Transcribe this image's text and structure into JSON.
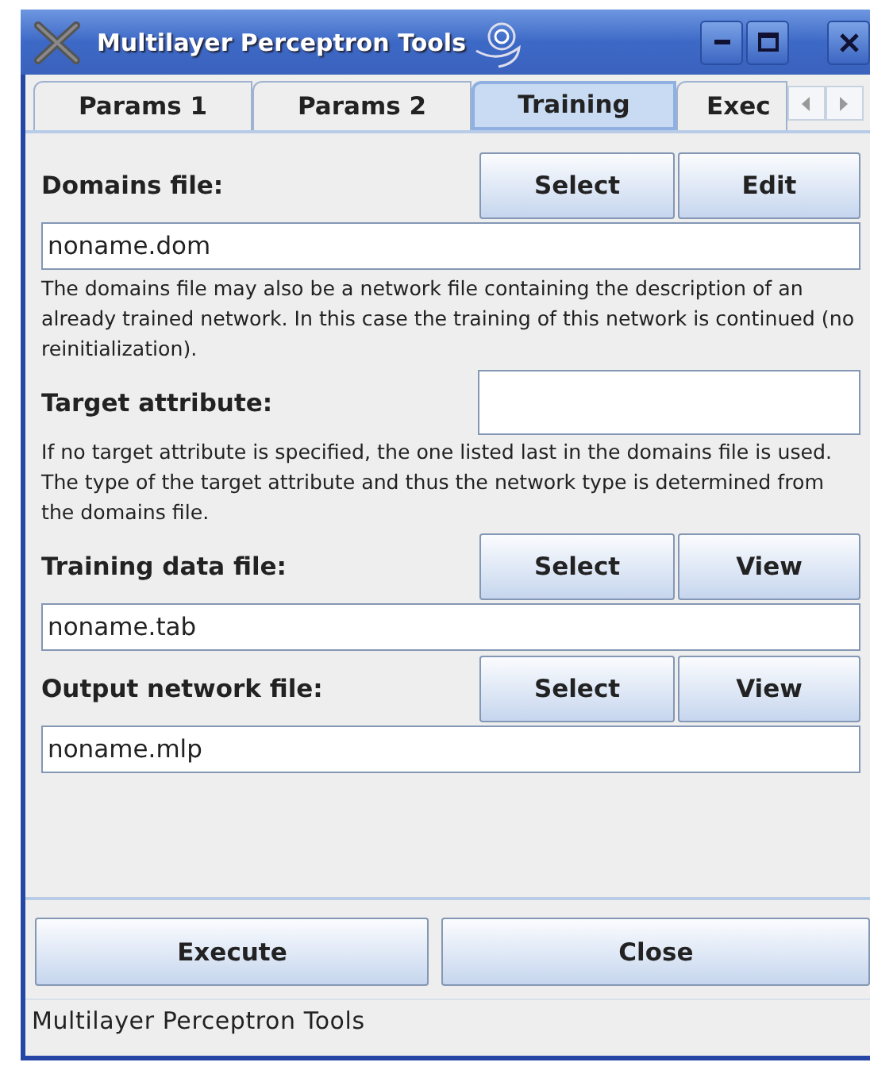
{
  "window": {
    "title": "Multilayer Perceptron Tools"
  },
  "tabs": [
    {
      "label": "Params 1",
      "selected": false
    },
    {
      "label": "Params 2",
      "selected": false
    },
    {
      "label": "Training",
      "selected": true
    },
    {
      "label": "Exec",
      "selected": false
    }
  ],
  "rows": [
    {
      "kind": "file",
      "label": "Domains file:",
      "buttons": [
        "Select",
        "Edit"
      ],
      "value": "noname.dom"
    },
    {
      "kind": "note",
      "text": "The domains file may also be a network file containing the description of an already trained network. In this case the training of this network is continued (no reinitialization)."
    },
    {
      "kind": "field",
      "label": "Target attribute:"
    },
    {
      "kind": "note",
      "text": "If no target attribute is specified, the one listed last in the domains file is used. The type of the target attribute and thus the network type is determined from the domains file."
    },
    {
      "kind": "file",
      "label": "Training data file:",
      "buttons": [
        "Select",
        "View"
      ],
      "value": "noname.tab"
    },
    {
      "kind": "file",
      "label": "Output network file:",
      "buttons": [
        "Select",
        "View"
      ],
      "value": "noname.mlp"
    }
  ],
  "buttons": [
    "Execute",
    "Close"
  ],
  "status_bar": "Multilayer Perceptron Tools"
}
